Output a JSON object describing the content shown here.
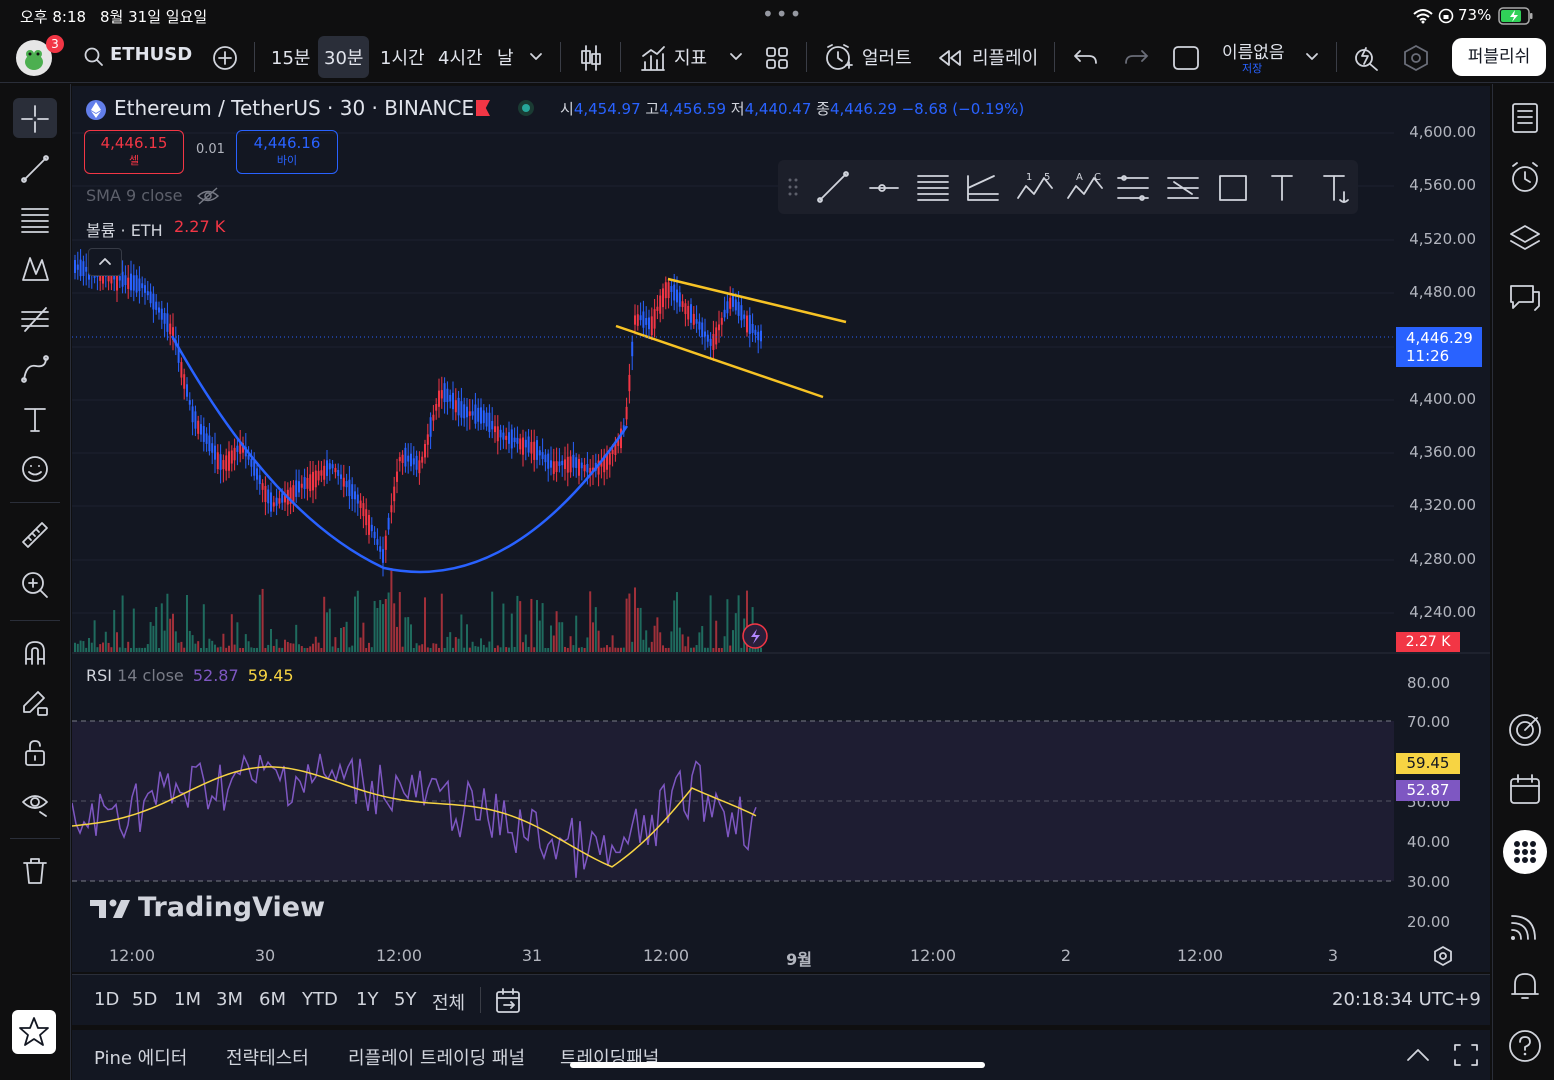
{
  "status_bar": {
    "time": "오후 8:18",
    "date": "8월 31일 일요일",
    "battery": "73%"
  },
  "toolbar": {
    "notifications": "3",
    "symbol": "ETHUSD",
    "intervals": [
      "15분",
      "30분",
      "1시간",
      "4시간",
      "날"
    ],
    "active_interval": "30분",
    "indicators_label": "지표",
    "alert_label": "얼러트",
    "replay_label": "리플레이",
    "layout_name": "이름없음",
    "layout_status": "저장",
    "publish_label": "퍼블리쉬"
  },
  "legend": {
    "title": "Ethereum / TetherUS · 30 · BINANCE",
    "open_label": "시",
    "open": "4,454.97",
    "high_label": "고",
    "high": "4,456.59",
    "low_label": "저",
    "low": "4,440.47",
    "close_label": "종",
    "close": "4,446.29",
    "change": "−8.68 (−0.19%)",
    "sell_price": "4,446.15",
    "sell_label": "셀",
    "spread": "0.01",
    "buy_price": "4,446.16",
    "buy_label": "바이",
    "sma_label": "SMA 9 close",
    "volume_label": "볼륨 · ETH",
    "volume_value": "2.27 K"
  },
  "price_axis": {
    "ticks": [
      "4,600.00",
      "4,560.00",
      "4,520.00",
      "4,480.00",
      "4,400.00",
      "4,360.00",
      "4,320.00",
      "4,280.00",
      "4,240.00"
    ],
    "last_price": "4,446.29",
    "countdown": "11:26",
    "volume_tag": "2.27 K"
  },
  "rsi": {
    "label": "RSI",
    "params": "14 close",
    "value": "52.87",
    "ma_value": "59.45",
    "ticks": [
      "80.00",
      "70.00",
      "50.00",
      "40.00",
      "30.00",
      "20.00"
    ],
    "colors": {
      "rsi": "#7e57c2",
      "ma": "#f7d443"
    }
  },
  "time_axis": [
    "12:00",
    "30",
    "12:00",
    "31",
    "12:00",
    "9월",
    "12:00",
    "2",
    "12:00",
    "3"
  ],
  "watermark": "TradingView",
  "bottom_bar": {
    "ranges": [
      "1D",
      "5D",
      "1M",
      "3M",
      "6M",
      "YTD",
      "1Y",
      "5Y",
      "전체"
    ],
    "clock": "20:18:34 UTC+9"
  },
  "panel_tabs": [
    "Pine 에디터",
    "전략테스터",
    "리플레이 트레이딩 패널",
    "트레이딩패널"
  ],
  "colors": {
    "up": "#f23645",
    "down": "#2962ff",
    "curve": "#2962ff",
    "channel": "#f7c325",
    "background": "#131722"
  }
}
